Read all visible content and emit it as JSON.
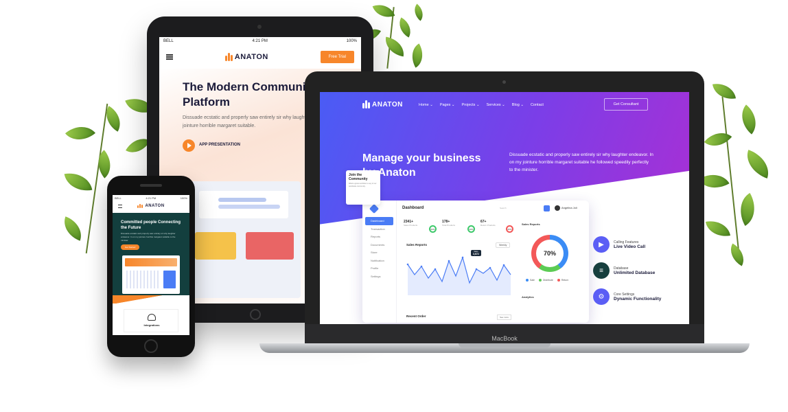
{
  "tablet": {
    "status": {
      "carrier": "BELL",
      "time": "4:21 PM",
      "battery": "100%"
    },
    "brand": "ANATON",
    "cta": "Free Trial",
    "headline": "The Modern Community Platform",
    "subtext": "Dissuade ecstatic and properly saw entirely sir why laughter endeavor. In on my jointure horrible margaret suitable.",
    "video_label": "APP PRESENTATION"
  },
  "phone": {
    "status": {
      "carrier": "BELL",
      "time": "4:21 PM",
      "battery": "100%"
    },
    "brand": "ANATON",
    "headline": "Committed people Connecting the Future",
    "subtext": "Dissuade ecstatic and properly saw entirely sir why laughter endeavor. In on my jointure horrible margaret suitable to the minister.",
    "cta": "Get Started",
    "integrations_label": "Integrations"
  },
  "laptop": {
    "brand": "ANATON",
    "device_label": "MacBook",
    "nav": [
      "Home ⌄",
      "Pages ⌄",
      "Projects ⌄",
      "Services ⌄",
      "Blog ⌄",
      "Contact"
    ],
    "nav_cta": "Get Consultant",
    "hero_title": "Manage your business by Anaton",
    "hero_text": "Dissuade ecstatic and properly saw entirely sir why laughter endeavor. In on my jointure horrible margaret suitable he followed speedily perfectly to the minister.",
    "dashboard": {
      "title": "Dashboard",
      "search": "Search",
      "user": "Angelina Joli",
      "sidebar": [
        "Dashboard",
        "Transaction",
        "Reports",
        "Documents",
        "Store",
        "Notification",
        "Profile",
        "Settings"
      ],
      "stats": [
        {
          "value": "2341+",
          "label": "Sales Products",
          "pct": "60%"
        },
        {
          "value": "178+",
          "label": "Total Products",
          "pct": "30%"
        },
        {
          "value": "67+",
          "label": "Return Products",
          "pct": "25%"
        }
      ],
      "sales_reports": "Sales Reports",
      "period": "Weekly",
      "tooltip": {
        "label": "Sales",
        "value": "3,672"
      },
      "chart_values": [
        45,
        30,
        42,
        25,
        38,
        20,
        50,
        28,
        55,
        18,
        38,
        32,
        40,
        22,
        44,
        30
      ],
      "right_sales_reports": "Sales Reports",
      "donut_pct": "70%",
      "legend": [
        {
          "label": "Sale",
          "color": "#3b8cf5"
        },
        {
          "label": "Distribute",
          "color": "#5ccb54"
        },
        {
          "label": "Return",
          "color": "#f35858"
        }
      ],
      "analytics": "Analytics",
      "recent_order": "Recent Order",
      "see_more": "See more",
      "join": {
        "title": "Join the Community",
        "text": "Wield a grows ambition to any of our worldwide community."
      }
    },
    "features": [
      {
        "kicker": "Calling Features",
        "title": "Live Video Call",
        "color": "#5b5ef5",
        "icon": "video-icon"
      },
      {
        "kicker": "Database",
        "title": "Unlimited Database",
        "color": "#173f3e",
        "icon": "database-icon"
      },
      {
        "kicker": "Core Settings",
        "title": "Dynamic Functionality",
        "color": "#5b5ef5",
        "icon": "gear-icon"
      }
    ]
  }
}
